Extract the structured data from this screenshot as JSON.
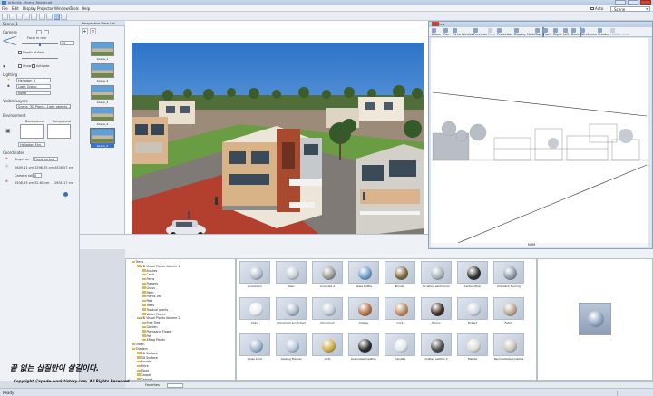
{
  "window": {
    "title": "Artlantis - Scene_Render.atl"
  },
  "menubar": {
    "items": [
      "File",
      "Edit",
      "Display",
      "Projector",
      "Windows",
      "Tools",
      "Help"
    ],
    "auto_label": "Auto",
    "scene_selector": "Scene"
  },
  "left_panel": {
    "header": "Scene_1",
    "camera": {
      "title": "Camera",
      "focal_label": "Focal in mm",
      "focal_value": "35",
      "depth_of_field_label": "Depth of field",
      "show_label": "Show",
      "activate_label": "Activate"
    },
    "lighting": {
      "title": "Lighting",
      "heliodon": "Heliodon_1",
      "light_group": "Light Group",
      "none": "None"
    },
    "visible_layers": {
      "title": "Visible Layers",
      "value": "Scene, 3D Plants, Light objects, A..."
    },
    "environment": {
      "title": "Environment",
      "background": "Background",
      "foreground": "Foreground",
      "heliodon_env": "Heliodon Env."
    },
    "coordinates": {
      "title": "Coordinates",
      "target_on": "Target on",
      "target_on_value": "Fixed vertex",
      "camera_values": [
        "2649.41 cm",
        "1296.75 cm",
        "4526.57 cm"
      ],
      "camera_roll_label": "Camera roll",
      "camera_roll_value": "0",
      "target_values": [
        "1508.93 cm",
        "32.61 cm",
        "2631.17 cm"
      ]
    }
  },
  "thumbnails": {
    "header": "Perspective View List",
    "items": [
      "Scene_1",
      "Scene_2",
      "Scene_3",
      "Scene_4",
      "Scene_5"
    ],
    "selected": "Scene_5"
  },
  "view2d": {
    "title": "2D View",
    "tools": [
      "Zoom",
      "Pan",
      "Fit to Window",
      "Previous",
      "Next",
      "Projection",
      "Display Mode",
      "Top",
      "Front",
      "Right",
      "Left",
      "Back",
      "Wireframe",
      "Shaded",
      "Hidden Line"
    ],
    "active_tools": [
      "Front",
      "Wireframe"
    ],
    "disabled_tools": [
      "Next",
      "Hidden Line"
    ],
    "status": "NUM"
  },
  "tree": {
    "items": [
      "Trees",
      "VB Visual Plants Volume 1",
      "Bushes",
      "Cacti",
      "Ferns",
      "Flowers",
      "Grass",
      "Palm",
      "Plants Var",
      "Pots",
      "Trees",
      "Tropical plants",
      "Water Plants",
      "VB Visual Plants Volume 2",
      "Free Tree",
      "Garden",
      "Plantsand Flower",
      "Pot",
      "XFrog Plants",
      "Urban",
      "Shaders",
      "2D Surface",
      "3D Surface",
      "Arcade",
      "Brick",
      "Block",
      "Carpet",
      "Cabinet"
    ]
  },
  "materials": [
    {
      "name": "Aluminium",
      "color": "#b7bfcb"
    },
    {
      "name": "Basic",
      "color": "#c5ccd6"
    },
    {
      "name": "Concrete 2",
      "color": "#9a9a96"
    },
    {
      "name": "Glass bottle",
      "color": "#6f9cc7"
    },
    {
      "name": "Bronze",
      "color": "#7c6a3c"
    },
    {
      "name": "Brushed aluminium",
      "color": "#a9b1bc"
    },
    {
      "name": "Carbon fiber",
      "color": "#2e2e2e"
    },
    {
      "name": "Chainlink fencing",
      "color": "#8f99a7"
    },
    {
      "name": "China",
      "color": "#e9edf3"
    },
    {
      "name": "Chromium scratched",
      "color": "#aab6c6"
    },
    {
      "name": "Chromium",
      "color": "#c3ccd8"
    },
    {
      "name": "Copper",
      "color": "#b0704a"
    },
    {
      "name": "Cork",
      "color": "#b9895a"
    },
    {
      "name": "Ebony",
      "color": "#3a2a22"
    },
    {
      "name": "Expert",
      "color": "#cfd6e0"
    },
    {
      "name": "Fabric",
      "color": "#b6a792"
    },
    {
      "name": "Glass brick",
      "color": "#9bb4cc"
    },
    {
      "name": "Glazing Fresnel",
      "color": "#b4c7dc"
    },
    {
      "name": "Gold",
      "color": "#cfae45"
    },
    {
      "name": "Granulated leather",
      "color": "#2b2b2b"
    },
    {
      "name": "Invisible",
      "color": "#e3e7ed"
    },
    {
      "name": "Quilted leather 2",
      "color": "#4a4a4a"
    },
    {
      "name": "Marble",
      "color": "#dcdcd8"
    },
    {
      "name": "Reconstituted marble",
      "color": "#c9c5bc"
    }
  ],
  "filter_bar": {
    "label": "Favorites"
  },
  "statusbar": {
    "text": "Ready"
  },
  "watermark": {
    "line1": "끝 없는 삽질만이 살길이다.",
    "line2": "Copyright ⓒspade-work.tistory.com, All Rights Reserved."
  },
  "colors": {
    "accent": "#3b73c9",
    "sky": "#5ea8e6",
    "lawn": "#5e8e3a"
  }
}
